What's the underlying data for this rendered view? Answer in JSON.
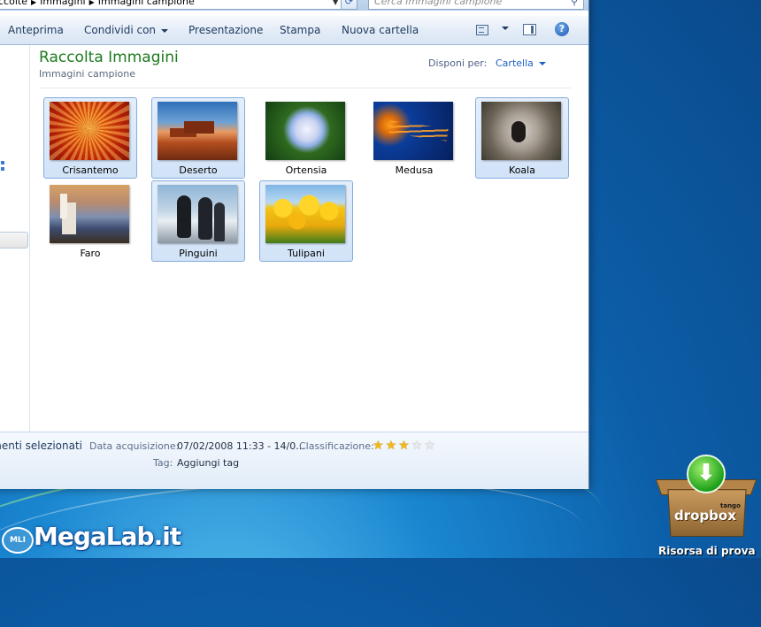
{
  "address_bar": {
    "crumbs": [
      "ccolte",
      "Immagini",
      "Immagini campione"
    ]
  },
  "search": {
    "placeholder": "Cerca Immagini campione"
  },
  "toolbar": {
    "preview": "Anteprima",
    "share": "Condividi con",
    "slideshow": "Presentazione",
    "print": "Stampa",
    "new_folder": "Nuova cartella",
    "help": "?"
  },
  "library": {
    "title": "Raccolta Immagini",
    "subtitle": "Immagini campione",
    "arrange_label": "Disponi per:",
    "arrange_value": "Cartella"
  },
  "pictures": [
    {
      "name": "Crisantemo",
      "selected": true
    },
    {
      "name": "Deserto",
      "selected": true
    },
    {
      "name": "Ortensia",
      "selected": false
    },
    {
      "name": "Medusa",
      "selected": false
    },
    {
      "name": "Koala",
      "selected": true
    },
    {
      "name": "Faro",
      "selected": false
    },
    {
      "name": "Pinguini",
      "selected": true
    },
    {
      "name": "Tulipani",
      "selected": true
    }
  ],
  "details": {
    "selection": "menti selezionati",
    "date_label": "Data acquisizione:",
    "date_value": "07/02/2008 11:33 - 14/0...",
    "rating_label": "Classificazione:",
    "rating": 3,
    "rating_max": 5,
    "tag_label": "Tag:",
    "tag_value": "Aggiungi tag"
  },
  "desktop": {
    "watermark": "MegaLab.it",
    "watermark_badge": "MLI",
    "dropbox_small": "tango",
    "dropbox_brand": "dropbox",
    "caption": "Risorsa di prova"
  },
  "colors": {
    "library_title": "#1e7a1e",
    "selection_fill": "#d2e3f8",
    "link_blue": "#1e62c4"
  }
}
